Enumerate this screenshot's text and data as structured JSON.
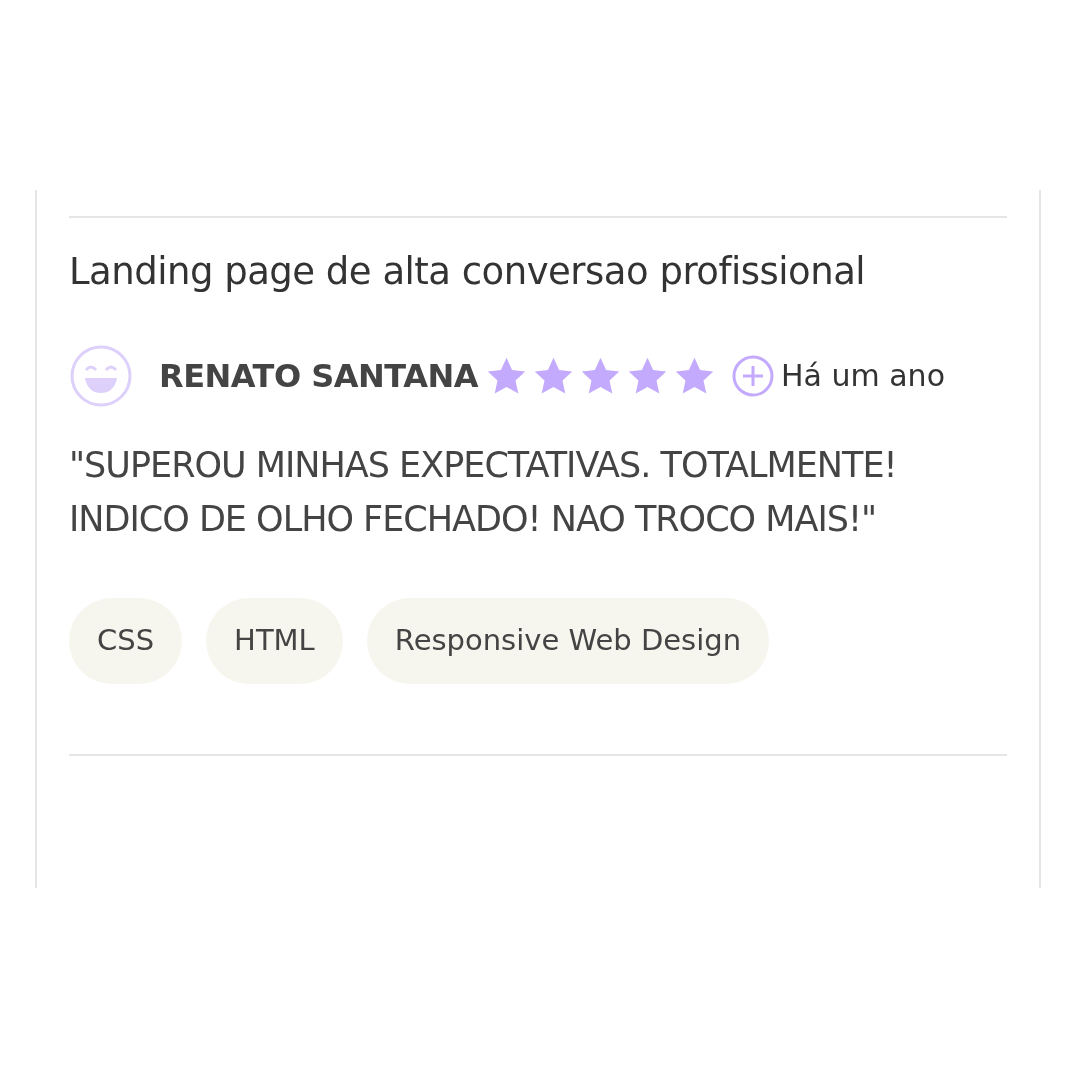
{
  "review": {
    "title": "Landing page de alta conversao profissional",
    "author": "RENATO SANTANA",
    "stars": 5,
    "time": "Há um ano",
    "text": "\"SUPEROU MINHAS EXPECTATIVAS. TOTALMENTE! INDICO DE OLHO FECHADO! NAO TROCO MAIS!\"",
    "tags": [
      "CSS",
      "HTML",
      "Responsive Web Design"
    ]
  }
}
